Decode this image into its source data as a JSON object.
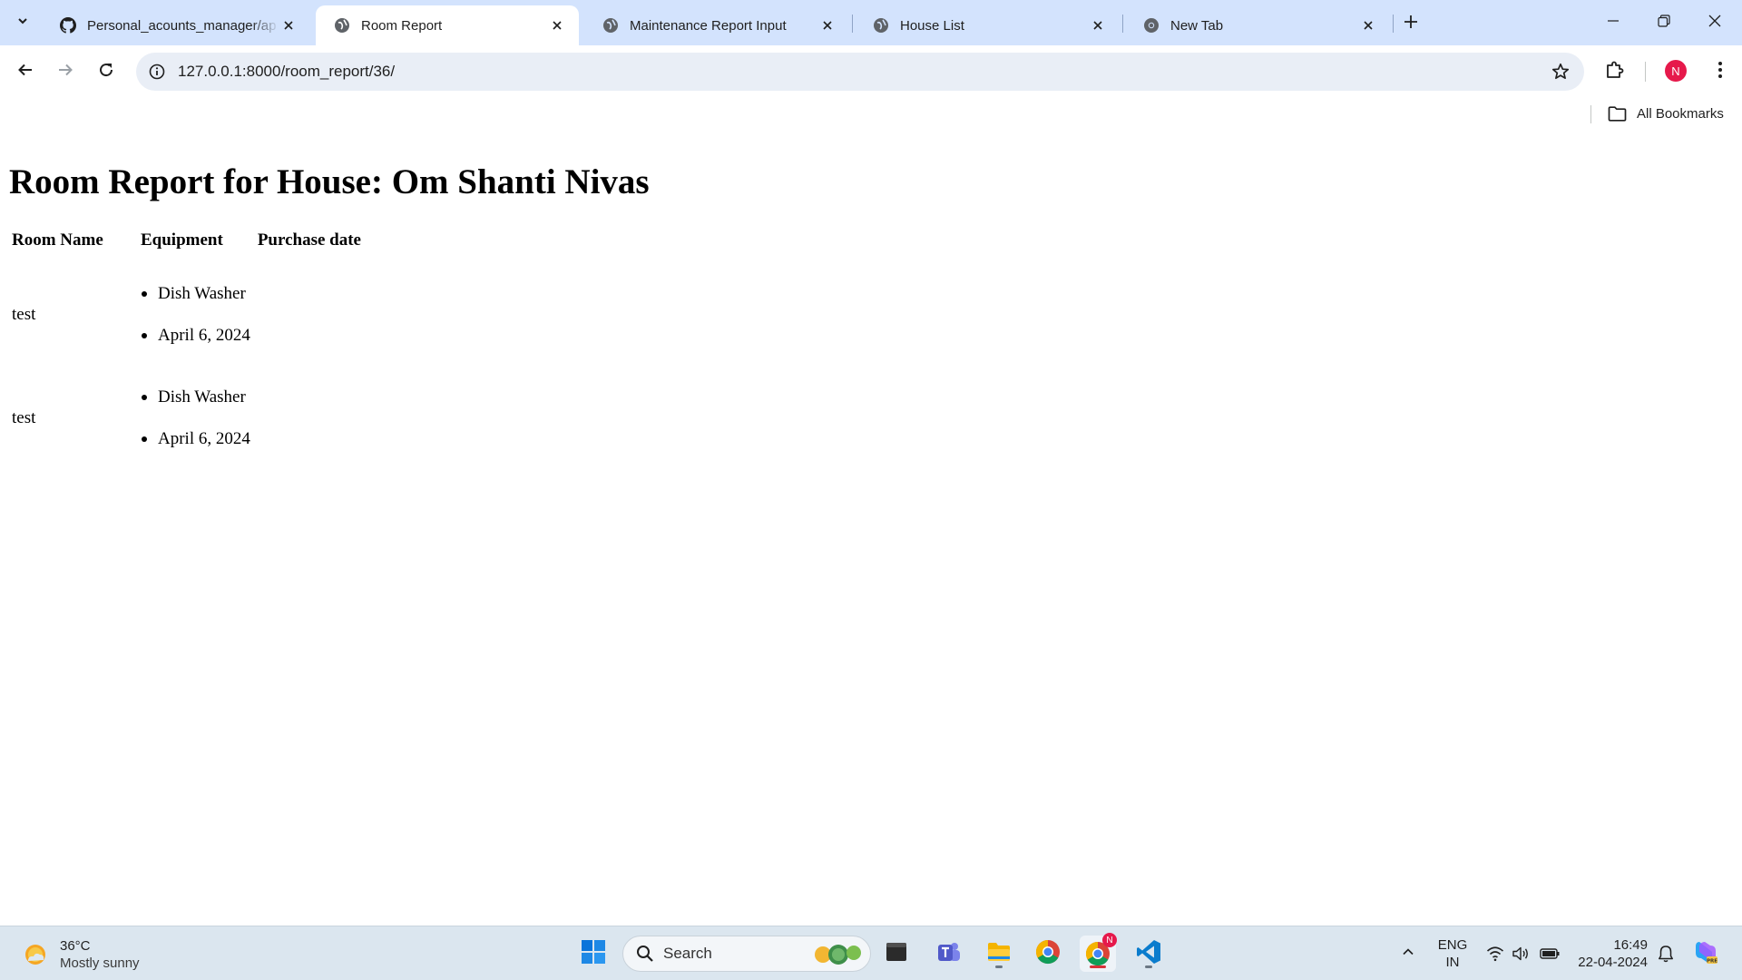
{
  "browser": {
    "tabs": [
      {
        "title": "Personal_acounts_manager/ap",
        "favicon": "github-icon",
        "active": false
      },
      {
        "title": "Room Report",
        "favicon": "globe-icon",
        "active": true
      },
      {
        "title": "Maintenance Report Input",
        "favicon": "globe-icon",
        "active": false
      },
      {
        "title": "House List",
        "favicon": "globe-icon",
        "active": false
      },
      {
        "title": "New Tab",
        "favicon": "chrome-icon",
        "active": false
      }
    ],
    "address_bar": {
      "url": "127.0.0.1:8000/room_report/36/"
    },
    "profile_initial": "N",
    "bookmarks": {
      "all_bookmarks_label": "All Bookmarks"
    }
  },
  "page": {
    "heading": "Room Report for House: Om Shanti Nivas",
    "table": {
      "headers": [
        "Room Name",
        "Equipment",
        "Purchase date"
      ],
      "rows": [
        {
          "room": "test",
          "equipment": "Dish Washer",
          "purchase_date": "April 6, 2024"
        },
        {
          "room": "test",
          "equipment": "Dish Washer",
          "purchase_date": "April 6, 2024"
        }
      ]
    }
  },
  "taskbar": {
    "weather": {
      "temperature": "36°C",
      "condition": "Mostly sunny"
    },
    "search_label": "Search",
    "language": {
      "line1": "ENG",
      "line2": "IN"
    },
    "clock": {
      "time": "16:49",
      "date": "22-04-2024"
    },
    "chrome_badge": "N"
  },
  "colors": {
    "tabstrip": "#d3e3fd",
    "omnibox": "#e9eef6",
    "avatar": "#e6194b",
    "taskbar": "#dbe6ef"
  }
}
